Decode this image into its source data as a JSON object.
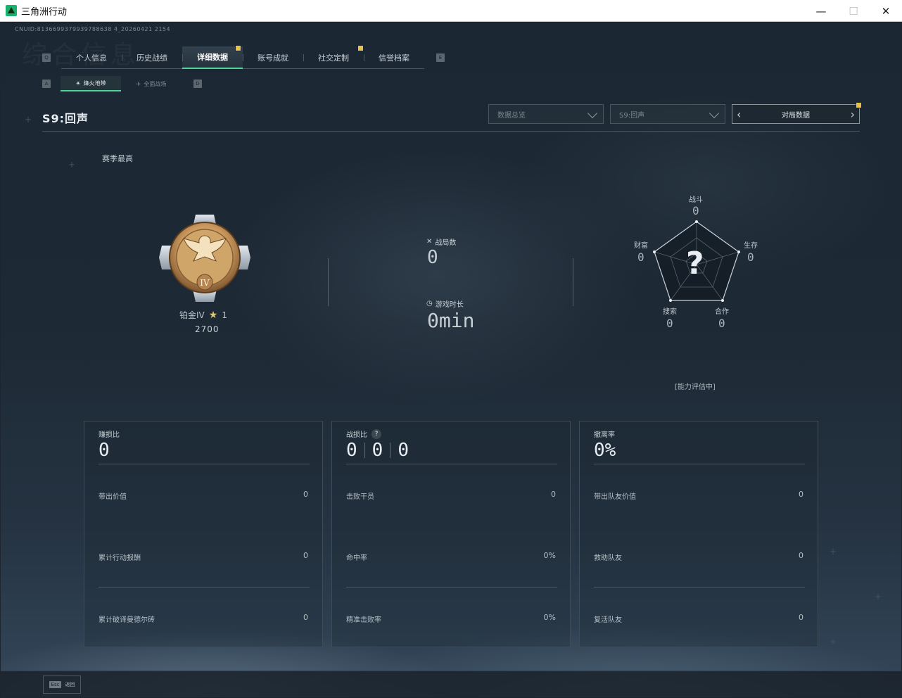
{
  "window": {
    "title": "三角洲行动",
    "minimize": "—",
    "maximize": "☐",
    "close": "✕"
  },
  "header": {
    "cnuid": "CNUID:8136699379939788638 4_20260421 2154",
    "ghost_title": "综合信息"
  },
  "main_tabs": {
    "key_left": "Q",
    "key_right": "E",
    "items": [
      {
        "label": "个人信息"
      },
      {
        "label": "历史战绩"
      },
      {
        "label": "详细数据"
      },
      {
        "label": "账号成就"
      },
      {
        "label": "社交定制"
      },
      {
        "label": "信誉档案"
      }
    ]
  },
  "sub_tabs": {
    "key_left": "A",
    "key_right": "D",
    "items": [
      {
        "label": "烽火地带"
      },
      {
        "label": "全面战场"
      }
    ]
  },
  "season": {
    "title": "S9:回声"
  },
  "filters": {
    "data_type": "数据总览",
    "season": "S9:回声",
    "pager_label": "对局数据",
    "pager_prev": "‹",
    "pager_next": "›"
  },
  "season_best": {
    "label": "赛季最高",
    "rank": "铂金IV",
    "stars": "1",
    "score": "2700",
    "medal_numeral": "IV"
  },
  "summary": {
    "matches_label": "战局数",
    "matches_value": "0",
    "playtime_label": "游戏时长",
    "playtime_value": "0min"
  },
  "radar": {
    "unknown_mark": "?",
    "combat_label": "战斗",
    "combat_value": "0",
    "survival_label": "生存",
    "survival_value": "0",
    "cooperation_label": "合作",
    "cooperation_value": "0",
    "search_label": "搜索",
    "search_value": "0",
    "wealth_label": "财富",
    "wealth_value": "0",
    "assessing": "[能力评估中]"
  },
  "cards": [
    {
      "head": "赚损比",
      "big": "0",
      "rows": [
        {
          "label": "带出价值",
          "value": "0"
        },
        {
          "label": "累计行动报酬",
          "value": "0"
        },
        {
          "label": "累计破译曼德尔砖",
          "value": "0"
        }
      ]
    },
    {
      "head": "战损比",
      "help": "?",
      "ratio": [
        "0",
        "0",
        "0"
      ],
      "rows": [
        {
          "label": "击败干员",
          "value": "0"
        },
        {
          "label": "命中率",
          "value": "0%"
        },
        {
          "label": "精准击败率",
          "value": "0%"
        }
      ]
    },
    {
      "head": "撤离率",
      "big": "0%",
      "rows": [
        {
          "label": "带出队友价值",
          "value": "0"
        },
        {
          "label": "救助队友",
          "value": "0"
        },
        {
          "label": "复活队友",
          "value": "0"
        }
      ]
    }
  ],
  "footer": {
    "esc_key": "Esc",
    "back_label": "返回"
  },
  "colors": {
    "accent": "#4fd59a",
    "badge": "#e7c14a",
    "star": "#e3c873"
  }
}
